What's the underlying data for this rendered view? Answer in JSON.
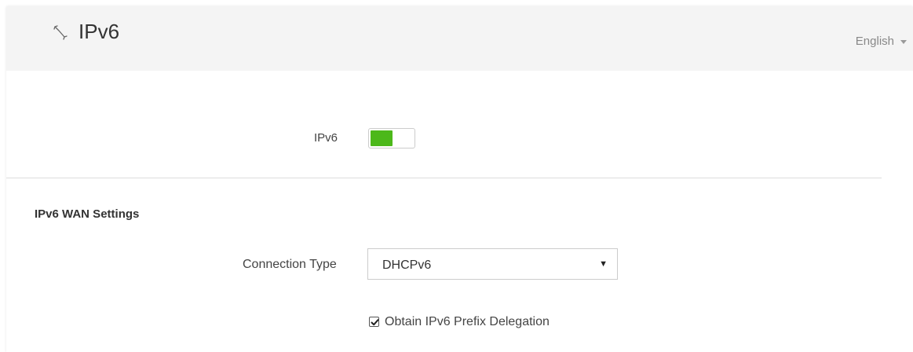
{
  "header": {
    "title": "IPv6",
    "title_icon": "wrench-icon",
    "language": "English"
  },
  "ipv6_toggle": {
    "label": "IPv6",
    "enabled": true,
    "on_color": "#4cb81a"
  },
  "wan_settings": {
    "section_title": "IPv6 WAN Settings",
    "connection_type_label": "Connection Type",
    "connection_type_value": "DHCPv6",
    "prefix_delegation_label": "Obtain IPv6 Prefix Delegation",
    "prefix_delegation_checked": true
  }
}
